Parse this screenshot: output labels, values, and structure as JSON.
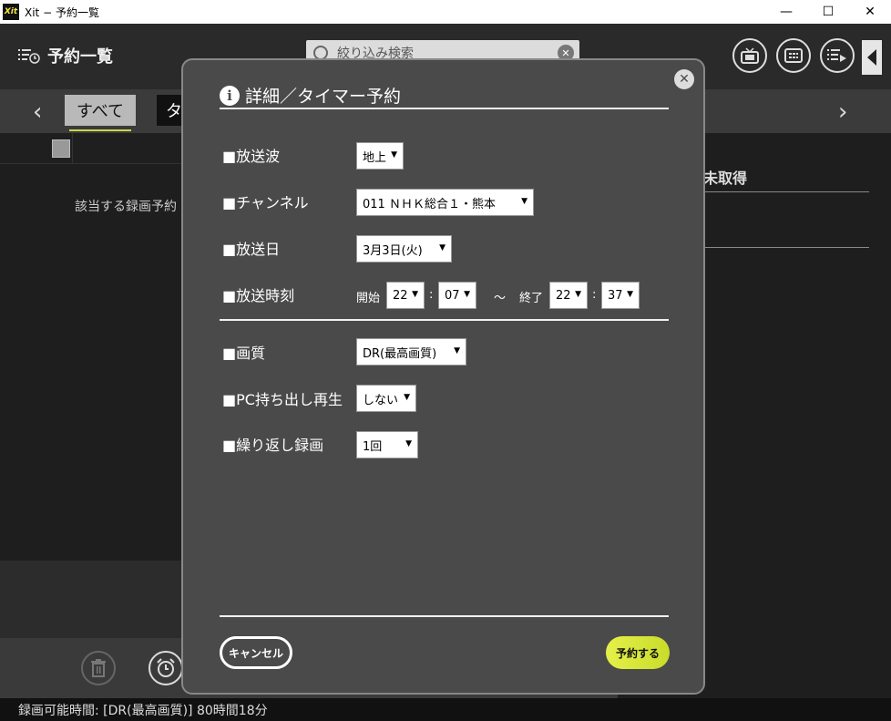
{
  "window": {
    "logo": "Xit",
    "title": "Xit − 予約一覧",
    "minimize": "—",
    "maximize": "☐",
    "close": "✕"
  },
  "header": {
    "page_title": "予約一覧",
    "search_placeholder": "絞り込み検索"
  },
  "tabs": {
    "prev_arrow": "‹",
    "next_arrow": "›",
    "all": "すべて",
    "second_partial": "タ"
  },
  "list": {
    "empty_message": "該当する録画予約"
  },
  "right_panel": {
    "title": "未取得"
  },
  "status": {
    "recordable_time": "録画可能時間: [DR(最高画質)] 80時間18分"
  },
  "modal": {
    "title": "詳細／タイマー予約",
    "fields": {
      "broadcast_label": "■放送波",
      "broadcast_value": "地上",
      "channel_label": "■チャンネル",
      "channel_value": "011 ＮＨＫ総合１・熊本",
      "date_label": "■放送日",
      "date_value": "3月3日(火)",
      "time_label": "■放送時刻",
      "start_label": "開始",
      "start_hour": "22",
      "start_min": "07",
      "tilde": "～",
      "end_label": "終了",
      "end_hour": "22",
      "end_min": "37",
      "colon": ":",
      "quality_label": "■画質",
      "quality_value": "DR(最高画質)",
      "pc_label": "■PC持ち出し再生",
      "pc_value": "しない",
      "repeat_label": "■繰り返し録画",
      "repeat_value": "1回"
    },
    "cancel_label": "キャンセル",
    "reserve_label": "予約する"
  }
}
